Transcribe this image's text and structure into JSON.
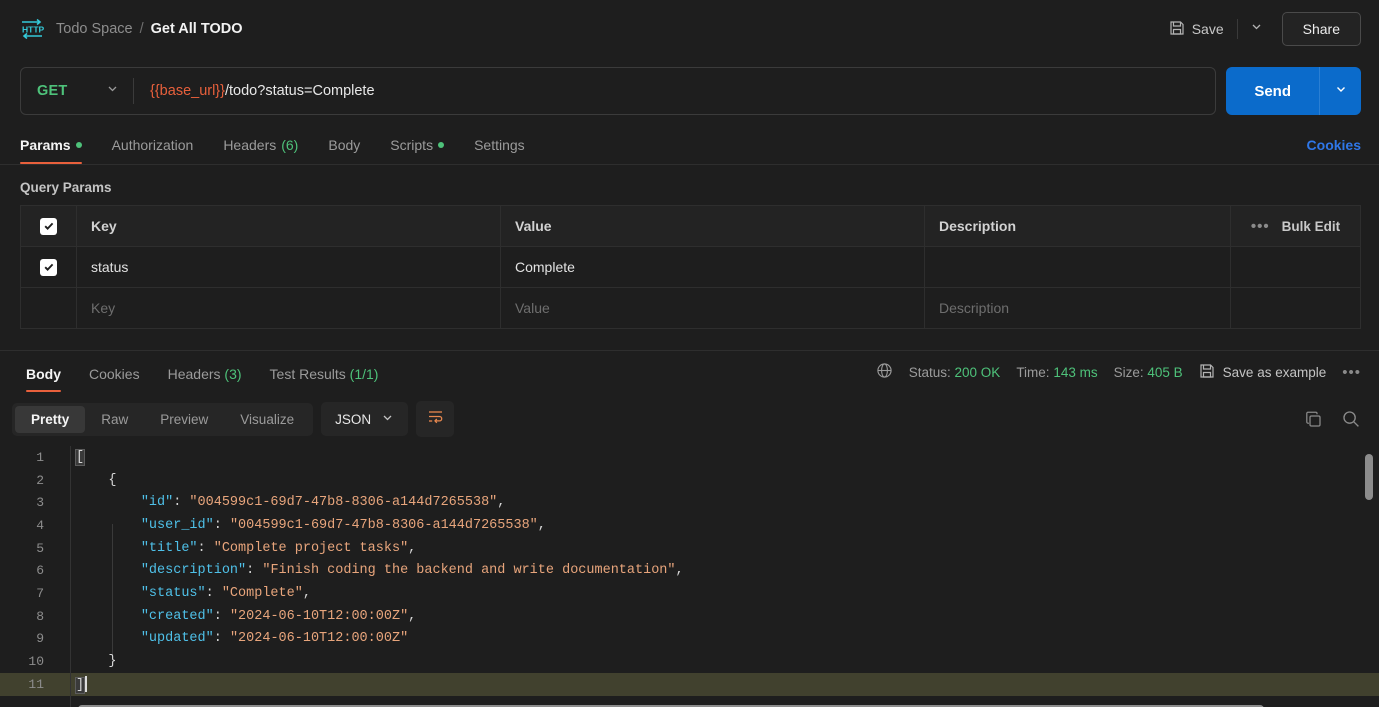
{
  "topbar": {
    "icon": "http-protocol-icon",
    "workspace": "Todo Space",
    "separator": "/",
    "request_name": "Get All TODO",
    "save_label": "Save",
    "save_icon": "floppy-disk-icon",
    "save_chevron_icon": "chevron-down-icon",
    "share_label": "Share"
  },
  "url_row": {
    "method": "GET",
    "method_chevron_icon": "chevron-down-icon",
    "url_variable": "{{base_url}}",
    "url_path": "/todo?status=Complete",
    "url_full": "{{base_url}}/todo?status=Complete",
    "send_label": "Send",
    "send_chevron_icon": "chevron-down-icon"
  },
  "request_tabs": {
    "items": [
      {
        "label": "Params",
        "active": true,
        "dot": true,
        "count": ""
      },
      {
        "label": "Authorization",
        "active": false,
        "dot": false,
        "count": ""
      },
      {
        "label": "Headers",
        "active": false,
        "dot": false,
        "count": "(6)"
      },
      {
        "label": "Body",
        "active": false,
        "dot": false,
        "count": ""
      },
      {
        "label": "Scripts",
        "active": false,
        "dot": true,
        "count": ""
      },
      {
        "label": "Settings",
        "active": false,
        "dot": false,
        "count": ""
      }
    ],
    "cookies_link": "Cookies"
  },
  "query_params": {
    "title": "Query Params",
    "headers": {
      "key": "Key",
      "value": "Value",
      "description": "Description"
    },
    "bulk_edit_label": "Bulk Edit",
    "more_icon": "ellipsis-icon",
    "rows": [
      {
        "checked": true,
        "key": "status",
        "value": "Complete",
        "description": ""
      }
    ],
    "placeholder_row": {
      "key": "Key",
      "value": "Value",
      "description": "Description"
    }
  },
  "response": {
    "tabs": [
      {
        "label": "Body",
        "active": true,
        "count": ""
      },
      {
        "label": "Cookies",
        "active": false,
        "count": ""
      },
      {
        "label": "Headers",
        "active": false,
        "count": "(3)"
      },
      {
        "label": "Test Results",
        "active": false,
        "count": "(1/1)"
      }
    ],
    "globe_icon": "globe-icon",
    "status_label": "Status:",
    "status_value": "200 OK",
    "time_label": "Time:",
    "time_value": "143 ms",
    "size_label": "Size:",
    "size_value": "405 B",
    "save_example_label": "Save as example",
    "save_example_icon": "floppy-disk-icon",
    "more_icon": "ellipsis-icon"
  },
  "body_toolbar": {
    "views": [
      {
        "label": "Pretty",
        "active": true
      },
      {
        "label": "Raw",
        "active": false
      },
      {
        "label": "Preview",
        "active": false
      },
      {
        "label": "Visualize",
        "active": false
      }
    ],
    "format": "JSON",
    "format_chevron_icon": "chevron-down-icon",
    "wrap_icon": "word-wrap-icon",
    "copy_icon": "copy-icon",
    "search_icon": "search-icon"
  },
  "code_body": {
    "language": "json",
    "lines": [
      {
        "n": "1",
        "segments": [
          {
            "t": "[",
            "c": "brk"
          }
        ]
      },
      {
        "n": "2",
        "segments": [
          {
            "t": "    {",
            "c": "p"
          }
        ]
      },
      {
        "n": "3",
        "segments": [
          {
            "t": "        ",
            "c": "p"
          },
          {
            "t": "\"id\"",
            "c": "k"
          },
          {
            "t": ": ",
            "c": "p"
          },
          {
            "t": "\"004599c1-69d7-47b8-8306-a144d7265538\"",
            "c": "s"
          },
          {
            "t": ",",
            "c": "p"
          }
        ]
      },
      {
        "n": "4",
        "segments": [
          {
            "t": "        ",
            "c": "p"
          },
          {
            "t": "\"user_id\"",
            "c": "k"
          },
          {
            "t": ": ",
            "c": "p"
          },
          {
            "t": "\"004599c1-69d7-47b8-8306-a144d7265538\"",
            "c": "s"
          },
          {
            "t": ",",
            "c": "p"
          }
        ]
      },
      {
        "n": "5",
        "segments": [
          {
            "t": "        ",
            "c": "p"
          },
          {
            "t": "\"title\"",
            "c": "k"
          },
          {
            "t": ": ",
            "c": "p"
          },
          {
            "t": "\"Complete project tasks\"",
            "c": "s"
          },
          {
            "t": ",",
            "c": "p"
          }
        ]
      },
      {
        "n": "6",
        "segments": [
          {
            "t": "        ",
            "c": "p"
          },
          {
            "t": "\"description\"",
            "c": "k"
          },
          {
            "t": ": ",
            "c": "p"
          },
          {
            "t": "\"Finish coding the backend and write documentation\"",
            "c": "s"
          },
          {
            "t": ",",
            "c": "p"
          }
        ]
      },
      {
        "n": "7",
        "segments": [
          {
            "t": "        ",
            "c": "p"
          },
          {
            "t": "\"status\"",
            "c": "k"
          },
          {
            "t": ": ",
            "c": "p"
          },
          {
            "t": "\"Complete\"",
            "c": "s"
          },
          {
            "t": ",",
            "c": "p"
          }
        ]
      },
      {
        "n": "8",
        "segments": [
          {
            "t": "        ",
            "c": "p"
          },
          {
            "t": "\"created\"",
            "c": "k"
          },
          {
            "t": ": ",
            "c": "p"
          },
          {
            "t": "\"2024-06-10T12:00:00Z\"",
            "c": "s"
          },
          {
            "t": ",",
            "c": "p"
          }
        ]
      },
      {
        "n": "9",
        "segments": [
          {
            "t": "        ",
            "c": "p"
          },
          {
            "t": "\"updated\"",
            "c": "k"
          },
          {
            "t": ": ",
            "c": "p"
          },
          {
            "t": "\"2024-06-10T12:00:00Z\"",
            "c": "s"
          }
        ]
      },
      {
        "n": "10",
        "segments": [
          {
            "t": "    }",
            "c": "p"
          }
        ]
      },
      {
        "n": "11",
        "segments": [
          {
            "t": "]",
            "c": "brk"
          }
        ],
        "cursor": true
      }
    ]
  },
  "colors": {
    "accent_orange": "#e8603c",
    "accent_blue": "#0b6bcb",
    "link_blue": "#2f77e8",
    "green": "#4ec27a",
    "json_key": "#4fc1e9",
    "json_string": "#e8a57c",
    "background": "#1e1e1e"
  }
}
